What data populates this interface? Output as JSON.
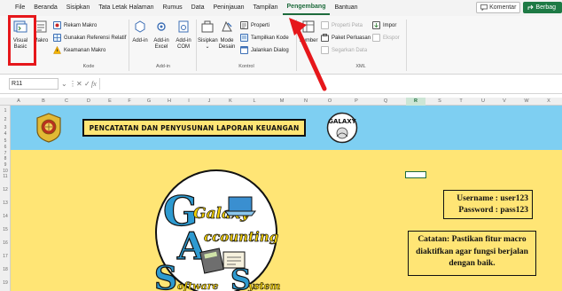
{
  "menubar": {
    "tabs": [
      "File",
      "Beranda",
      "Sisipkan",
      "Tata Letak Halaman",
      "Rumus",
      "Data",
      "Peninjauan",
      "Tampilan",
      "Pengembang",
      "Bantuan"
    ],
    "active_tab": "Pengembang",
    "comment_label": "Komentar",
    "share_label": "Berbag"
  },
  "ribbon": {
    "visual_basic": "Visual Basic",
    "macros": "Makro",
    "record_macro": "Rekam Makro",
    "relative_ref": "Gunakan Referensi Relatif",
    "macro_security": "Keamanan Makro",
    "code_group": "Kode",
    "addins": "Add-in",
    "excel_addins": "Add-in Excel",
    "com_addins": "Add-in COM",
    "addins_group": "Add-in",
    "insert": "Sisipkan",
    "design_mode": "Mode Desain",
    "properties": "Properti",
    "view_code": "Tampilkan Kode",
    "run_dialog": "Jalankan Dialog",
    "controls_group": "Kontrol",
    "source": "Sumber",
    "map_properties": "Properti Peta",
    "expansion_packs": "Paket Perluasan",
    "refresh_data": "Segarkan Data",
    "import": "Impor",
    "export": "Ekspor",
    "xml_group": "XML"
  },
  "formula_bar": {
    "name_box": "R11",
    "fx": "fx",
    "value": ""
  },
  "columns": [
    "A",
    "B",
    "C",
    "D",
    "E",
    "F",
    "G",
    "H",
    "I",
    "J",
    "K",
    "L",
    "M",
    "N",
    "O",
    "P",
    "Q",
    "R",
    "S",
    "T",
    "U",
    "V",
    "W",
    "X"
  ],
  "selected_column": "R",
  "rows": [
    "1",
    "2",
    "3",
    "4",
    "5",
    "6",
    "7",
    "8",
    "9",
    "10",
    "11",
    "12",
    "13",
    "14",
    "15",
    "16",
    "17",
    "18",
    "19"
  ],
  "sheet": {
    "title": "PENCATATAN DAN PENYUSUNAN LAPORAN KEUANGAN",
    "logo_text": "GALAXY",
    "big_logo_words": [
      "Galaxy",
      "ccounting",
      "oftware",
      "ystem"
    ],
    "big_logo_letters": [
      "G",
      "A",
      "S",
      "S"
    ],
    "username": "Username : user123",
    "password": "Password : pass123",
    "note": "Catatan: Pastikan fitur macro diaktifkan agar fungsi berjalan dengan baik."
  },
  "colors": {
    "banner": "#7ecff2",
    "sheet_bg": "#ffe575",
    "accent": "#1e6b3c",
    "annotation": "#e6171b"
  }
}
